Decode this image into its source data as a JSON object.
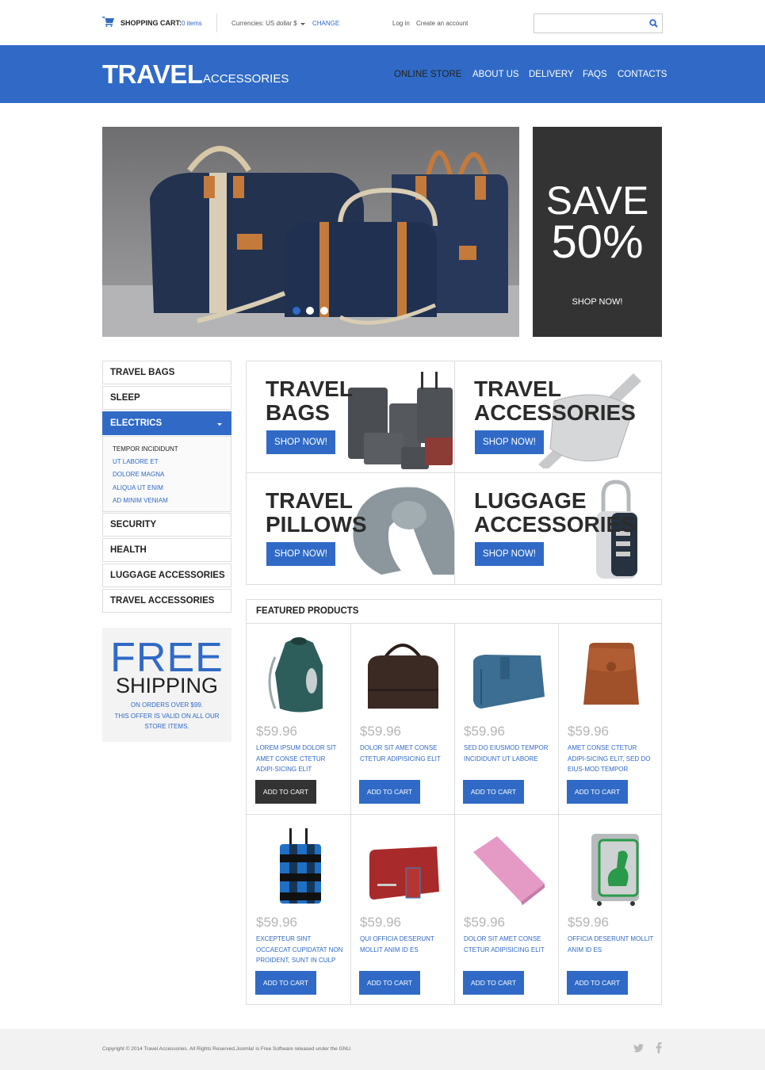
{
  "topbar": {
    "cart_label": "SHOPPING CART:",
    "cart_count": "0 items",
    "currency_label": "Currencies:  US dollar $",
    "currency_change": "CHANGE",
    "login": "Log in",
    "create_account": "Create an account",
    "search_placeholder": ""
  },
  "header": {
    "logo_main": "TRAVEL",
    "logo_sub": "ACCESSORIES",
    "nav": [
      "ONLINE STORE",
      "ABOUT US",
      "DELIVERY",
      "FAQS",
      "CONTACTS"
    ],
    "active_nav": "ONLINE STORE"
  },
  "slider": {
    "slides": 3,
    "active_slide": 1
  },
  "promo": {
    "line1": "SAVE",
    "line2": "50%",
    "cta": "SHOP NOW!"
  },
  "sidebar": {
    "categories": [
      "TRAVEL BAGS",
      "SLEEP",
      "ELECTRICS",
      "SECURITY",
      "HEALTH",
      "LUGGAGE  ACCESSORIES",
      "TRAVEL  ACCESSORIES"
    ],
    "active_category": "ELECTRICS",
    "subcategories": [
      "TEMPOR INCIDIDUNT",
      "UT LABORE ET",
      "DOLORE MAGNA",
      "ALIQUA UT ENIM",
      "AD MINIM VENIAM"
    ],
    "free_shipping": {
      "big": "FREE",
      "sub": "SHIPPING",
      "note1": "ON ORDERS OVER $99.",
      "note2": "THIS OFFER IS VALID ON ALL OUR",
      "note3": "STORE ITEMS."
    }
  },
  "banners": [
    {
      "line1": "TRAVEL",
      "line2": "BAGS",
      "cta": "SHOP NOW!"
    },
    {
      "line1": "TRAVEL",
      "line2": "ACCESSORIES",
      "cta": "SHOP NOW!"
    },
    {
      "line1": "TRAVEL",
      "line2": "PILLOWS",
      "cta": "SHOP NOW!"
    },
    {
      "line1": "LUGGAGE",
      "line2": "ACCESSORIES",
      "cta": "SHOP NOW!"
    }
  ],
  "featured": {
    "title": "FEATURED PRODUCTS",
    "products": [
      {
        "price": "$59.96",
        "name": "LOREM IPSUM DOLOR SIT AMET CONSE CTETUR ADIPI-SICING ELIT",
        "cta": "ADD TO CART",
        "image": "green-backpack"
      },
      {
        "price": "$59.96",
        "name": "DOLOR SIT AMET CONSE CTETUR ADIPISICING ELIT",
        "cta": "ADD TO CART",
        "image": "brown-duffel-bag"
      },
      {
        "price": "$59.96",
        "name": "SED DO EIUSMOD TEMPOR INCIDIDUNT UT LABORE",
        "cta": "ADD TO CART",
        "image": "blue-wallet"
      },
      {
        "price": "$59.96",
        "name": "AMET CONSE CTETUR ADIPI-SICING ELIT, SED DO EIUS-MOD TEMPOR",
        "cta": "ADD TO CART",
        "image": "brown-leather-backpack"
      },
      {
        "price": "$59.96",
        "name": "EXCEPTEUR SINT OCCAECAT CUPIDATAT NON PROIDENT, SUNT IN CULP",
        "cta": "ADD TO CART",
        "image": "blue-plaid-suitcase"
      },
      {
        "price": "$59.96",
        "name": "QUI OFFICIA DESERUNT MOLLIT ANIM ID ES",
        "cta": "ADD TO CART",
        "image": "red-wallet"
      },
      {
        "price": "$59.96",
        "name": "DOLOR SIT AMET CONSE CTETUR ADIPISICING ELIT",
        "cta": "ADD TO CART",
        "image": "pink-organizer"
      },
      {
        "price": "$59.96",
        "name": "OFFICIA DESERUNT MOLLIT ANIM ID ES",
        "cta": "ADD TO CART",
        "image": "dinosaur-kids-suitcase"
      }
    ]
  },
  "footer": {
    "copyright": "Copyright © 2014 Travel  Accessories. All Rights Reserved.Joomla! is Free Software released under the GNU.",
    "social": [
      "twitter-icon",
      "facebook-icon"
    ]
  },
  "colors": {
    "brand_blue": "#306ac6",
    "dark": "#333333",
    "price_gray": "#b5b5b5"
  }
}
